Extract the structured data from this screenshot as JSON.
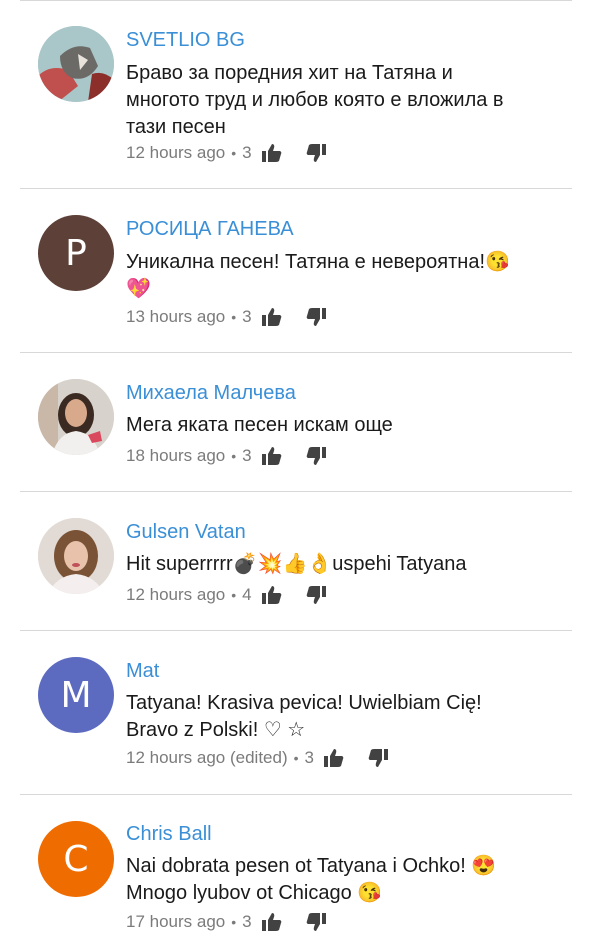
{
  "comments": [
    {
      "author": "SVETLIO BG",
      "lines": [
        "Браво за поредния хит на Татяна и",
        "многото труд и любов която е вложила в",
        "тази песен"
      ],
      "time": "12 hours ago",
      "likes": "3",
      "avatar": {
        "type": "photo",
        "icon": "cat-photo"
      }
    },
    {
      "author": "РОСИЦА ГАНЕВА",
      "lines": [
        "Уникална песен! Татяна е невероятна!😘",
        "💖"
      ],
      "time": "13 hours ago",
      "likes": "3",
      "avatar": {
        "type": "letter",
        "letter": "P",
        "color": "#5d4037"
      }
    },
    {
      "author": "Михаела Малчева",
      "lines": [
        "Мега яката песен искам още"
      ],
      "time": "18 hours ago",
      "likes": "3",
      "avatar": {
        "type": "photo",
        "icon": "woman-photo"
      }
    },
    {
      "author": "Gulsen Vatan",
      "lines": [
        "Hit superrrrr💣💥👍👌uspehi Tatyana"
      ],
      "time": "12 hours ago",
      "likes": "4",
      "avatar": {
        "type": "photo",
        "icon": "woman-blonde-photo"
      }
    },
    {
      "author": "Mat",
      "lines": [
        "Tatyana! Krasiva pevica! Uwielbiam Cię!",
        "Bravo z Polski! ♡ ☆"
      ],
      "time": "12 hours ago (edited)",
      "likes": "3",
      "avatar": {
        "type": "letter",
        "letter": "M",
        "color": "#5c6bc0"
      }
    },
    {
      "author": "Chris Ball",
      "lines": [
        "Nai dobrata pesen ot Tatyana i Ochko! 😍",
        "Mnogo lyubov ot Chicago 😘"
      ],
      "time": "17 hours ago",
      "likes": "3",
      "avatar": {
        "type": "letter",
        "letter": "C",
        "color": "#ef6c00"
      }
    }
  ],
  "colors": {
    "author": "#3a8fd6",
    "meta": "#7b7b7b",
    "icon": "#424242",
    "divider": "#d8d8d8"
  }
}
